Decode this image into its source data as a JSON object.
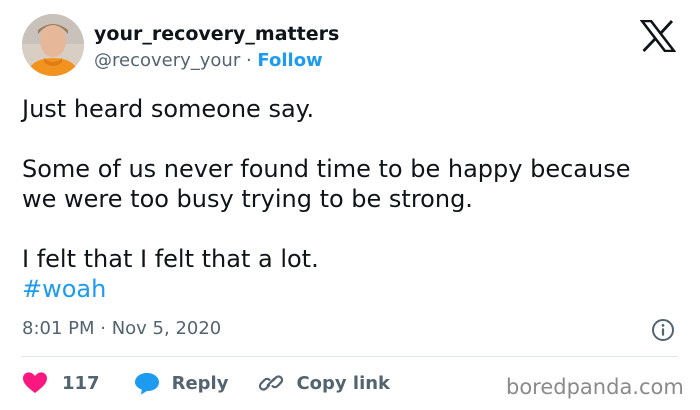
{
  "author": {
    "display_name": "your_recovery_matters",
    "handle": "@recovery_your",
    "separator": " · ",
    "follow_label": "Follow"
  },
  "tweet": {
    "line1": "Just heard someone say.",
    "line2": "Some of us never found time to be happy because",
    "line3": "we were too busy trying to be strong.",
    "line4": "I felt that I felt that a lot.",
    "hashtag": "#woah"
  },
  "meta": {
    "timestamp": "8:01 PM · Nov 5, 2020"
  },
  "actions": {
    "like_count": "117",
    "reply_label": "Reply",
    "copy_label": "Copy link"
  },
  "watermark": "boredpanda.com",
  "icons": {
    "logo": "x-logo-icon",
    "info": "info-icon",
    "like": "heart-icon",
    "reply": "speech-bubble-icon",
    "copy": "link-icon"
  },
  "colors": {
    "accent": "#1d9bf0",
    "like": "#f91880",
    "muted": "#536471",
    "text": "#0f1419"
  }
}
